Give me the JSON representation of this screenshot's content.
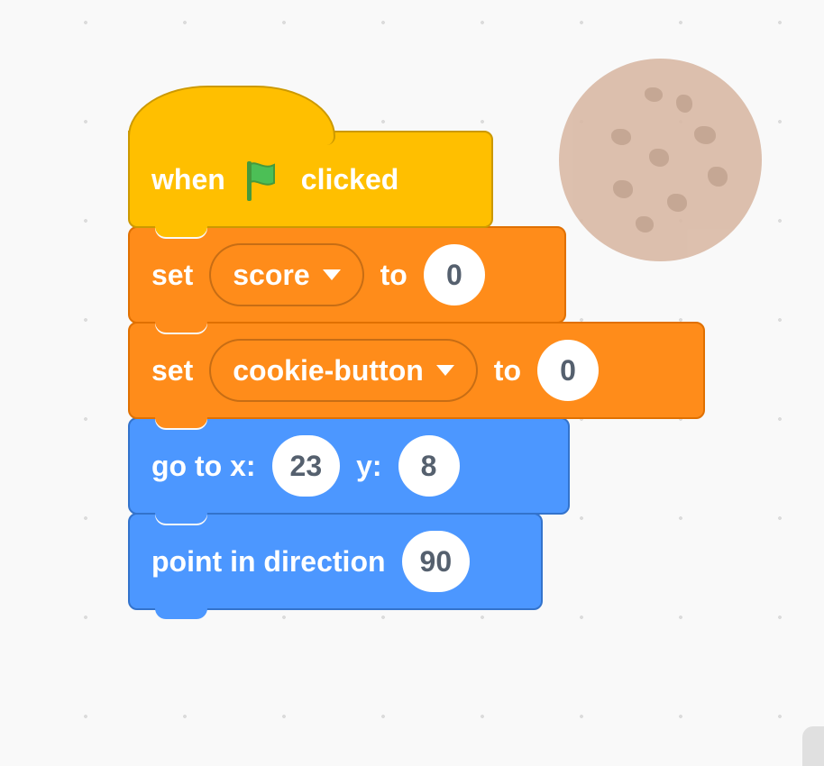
{
  "hat": {
    "prefix": "when",
    "suffix": "clicked"
  },
  "blocks": {
    "set1": {
      "label_set": "set",
      "variable": "score",
      "label_to": "to",
      "value": "0"
    },
    "set2": {
      "label_set": "set",
      "variable": "cookie-button",
      "label_to": "to",
      "value": "0"
    },
    "goto": {
      "prefix": "go to x:",
      "x": "23",
      "mid": "y:",
      "y": "8"
    },
    "point": {
      "prefix": "point in direction",
      "dir": "90"
    }
  }
}
